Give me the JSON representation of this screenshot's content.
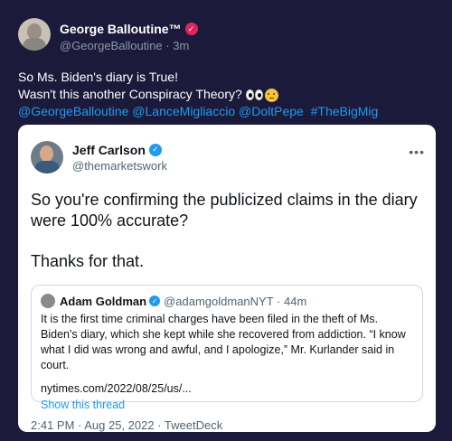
{
  "outer": {
    "name": "George Balloutine™",
    "handle": "@GeorgeBalloutine",
    "time": "· 3m",
    "line1": "So Ms. Biden's diary is True!",
    "line2": "Wasn't this another Conspiracy Theory?",
    "mentions": [
      "@GeorgeBalloutine",
      "@LanceMigliaccio",
      "@DoltPepe",
      "#TheBigMig"
    ]
  },
  "card": {
    "name": "Jeff Carlson",
    "handle": "@themarketswork",
    "text1": "So you're confirming the publicized claims in the diary were 100% accurate?",
    "text2": "Thanks for that.",
    "timestamp": "2:41 PM · Aug 25, 2022 · TweetDeck"
  },
  "quote": {
    "name": "Adam Goldman",
    "handle": "@adamgoldmanNYT · 44m",
    "text": "It is the first time criminal charges have been filed in the theft of Ms. Biden's diary, which she kept while she recovered from addiction. “I know what I did was wrong and awful, and I apologize,” Mr. Kurlander said in court.",
    "link": "nytimes.com/2022/08/25/us/...",
    "show_thread": "Show this thread"
  },
  "icons": {
    "verified_pink": "#e0245e",
    "verified_blue": "#1d9bf0"
  }
}
